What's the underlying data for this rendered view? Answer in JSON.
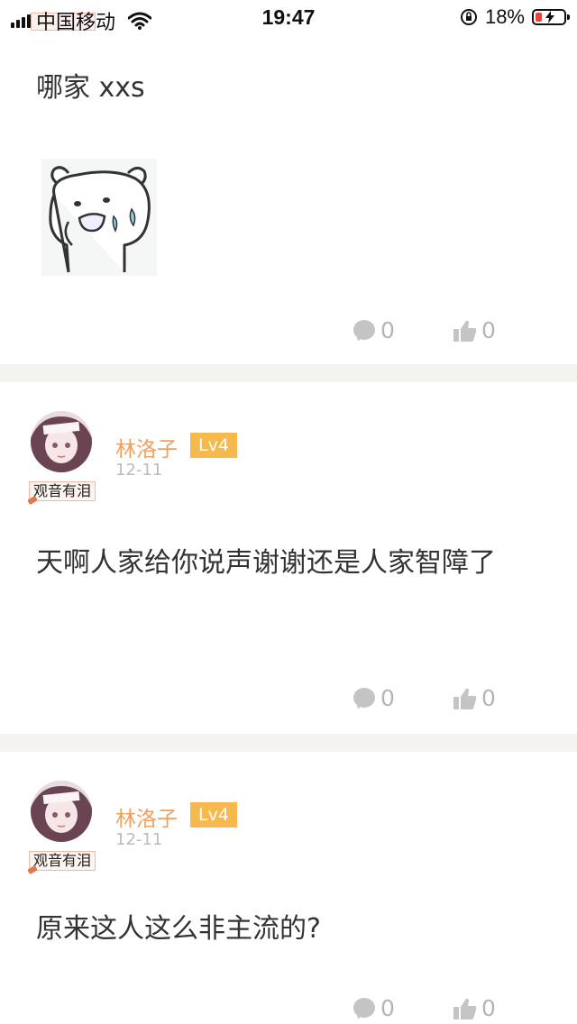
{
  "status_bar": {
    "carrier": "中国移动",
    "time": "19:47",
    "battery_percent": "18%",
    "icons": [
      "signal-icon",
      "wifi-icon",
      "orientation-lock-icon",
      "battery-charging-icon"
    ]
  },
  "posts": [
    {
      "text": "哪家 xxs",
      "has_sticker": true,
      "comments": "0",
      "likes": "0"
    },
    {
      "username": "林洛子",
      "level": "Lv4",
      "date": "12-11",
      "badge": "观音有泪",
      "text": "天啊人家给你说声谢谢还是人家智障了",
      "comments": "0",
      "likes": "0"
    },
    {
      "username": "林洛子",
      "level": "Lv4",
      "date": "12-11",
      "badge": "观音有泪",
      "text": "原来这人这么非主流的?",
      "comments": "0",
      "likes": "0"
    }
  ],
  "colors": {
    "username": "#f0a05e",
    "level_badge": "#f5b94d",
    "separator": "#f4f3ef",
    "action_gray": "#b5b5b5"
  }
}
